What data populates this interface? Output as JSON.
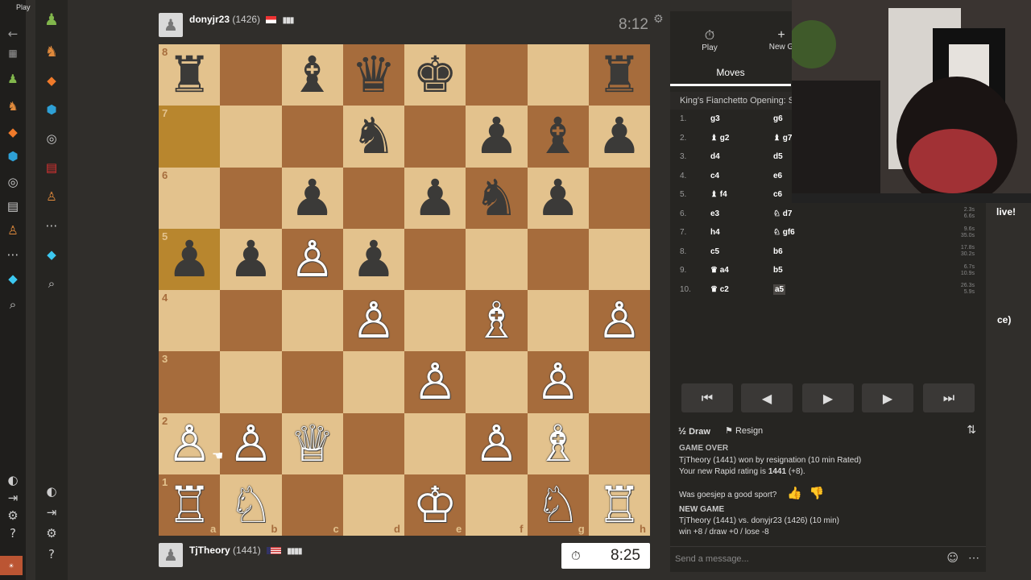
{
  "browser": {
    "tab_label": "Play"
  },
  "players": {
    "top": {
      "name": "donyjr23",
      "rating": "(1426)",
      "clock": "8:12"
    },
    "bottom": {
      "name": "TjTheory",
      "rating": "(1441)",
      "clock": "8:25"
    }
  },
  "board": {
    "ranks": [
      "8",
      "7",
      "6",
      "5",
      "4",
      "3",
      "2",
      "1"
    ],
    "files": [
      "a",
      "b",
      "c",
      "d",
      "e",
      "f",
      "g",
      "h"
    ],
    "pieces": [
      [
        "♜",
        "",
        "♝",
        "♛",
        "♚",
        "",
        "",
        "♜"
      ],
      [
        "",
        "",
        "",
        "♞",
        "",
        "♟",
        "♝",
        "♟"
      ],
      [
        "",
        "",
        "♟",
        "",
        "♟",
        "♞",
        "♟",
        ""
      ],
      [
        "♟",
        "♟",
        "♙",
        "♟",
        "",
        "",
        "",
        ""
      ],
      [
        "",
        "",
        "",
        "♙",
        "",
        "♗",
        "",
        "♙"
      ],
      [
        "",
        "",
        "",
        "",
        "♙",
        "",
        "♙",
        ""
      ],
      [
        "♙",
        "♙",
        "♕",
        "",
        "",
        "♙",
        "♗",
        ""
      ],
      [
        "♖",
        "♘",
        "",
        "",
        "♔",
        "",
        "♘",
        "♖"
      ]
    ],
    "highlighted": [
      "a7",
      "a5"
    ]
  },
  "panel": {
    "tabs": [
      {
        "label": "Play",
        "icon": "stopwatch-icon"
      },
      {
        "label": "New G",
        "icon": "plus-icon"
      }
    ],
    "moves_tab": "Moves",
    "opening": "King's Fianchetto Opening: Sym",
    "moves": [
      {
        "n": "1.",
        "w": "g3",
        "b": "g6",
        "t1": "",
        "t2": ""
      },
      {
        "n": "2.",
        "w": "♝ g2",
        "b": "♝ g7",
        "t1": "",
        "t2": ""
      },
      {
        "n": "3.",
        "w": "d4",
        "b": "d5",
        "t1": "",
        "t2": ""
      },
      {
        "n": "4.",
        "w": "c4",
        "b": "e6",
        "t1": "",
        "t2": ""
      },
      {
        "n": "5.",
        "w": "♝ f4",
        "b": "c6",
        "t1": "",
        "t2": ""
      },
      {
        "n": "6.",
        "w": "e3",
        "b": "♘ d7",
        "t1": "2.3s",
        "t2": "6.6s"
      },
      {
        "n": "7.",
        "w": "h4",
        "b": "♘ gf6",
        "t1": "9.6s",
        "t2": "35.0s"
      },
      {
        "n": "8.",
        "w": "c5",
        "b": "b6",
        "t1": "17.8s",
        "t2": "30.2s"
      },
      {
        "n": "9.",
        "w": "♛ a4",
        "b": "b5",
        "t1": "6.7s",
        "t2": "10.9s"
      },
      {
        "n": "10.",
        "w": "♛ c2",
        "b": "a5",
        "t1": "26.3s",
        "t2": "5.9s"
      }
    ],
    "draw_label": "Draw",
    "resign_label": "Resign",
    "chat": {
      "game_over": "GAME OVER",
      "result": "TjTheory (1441) won by resignation (10 min Rated)",
      "rating_prefix": "Your new Rapid rating is",
      "rating_value": "1441",
      "rating_change": "(+8).",
      "sport_question": "Was goesjep a good sport?",
      "new_game": "NEW GAME",
      "matchup": "TjTheory (1441) vs. donyjr23 (1426) (10 min)",
      "odds": "win +8 / draw +0 / lose -8"
    },
    "message_placeholder": "Send a message..."
  },
  "overlay": {
    "live": "live!",
    "partial": "ce)"
  },
  "colors": {
    "light_square": "#e3c28d",
    "dark_square": "#a66c3c",
    "highlight": "#d7a94a",
    "bg": "#302e2b"
  }
}
